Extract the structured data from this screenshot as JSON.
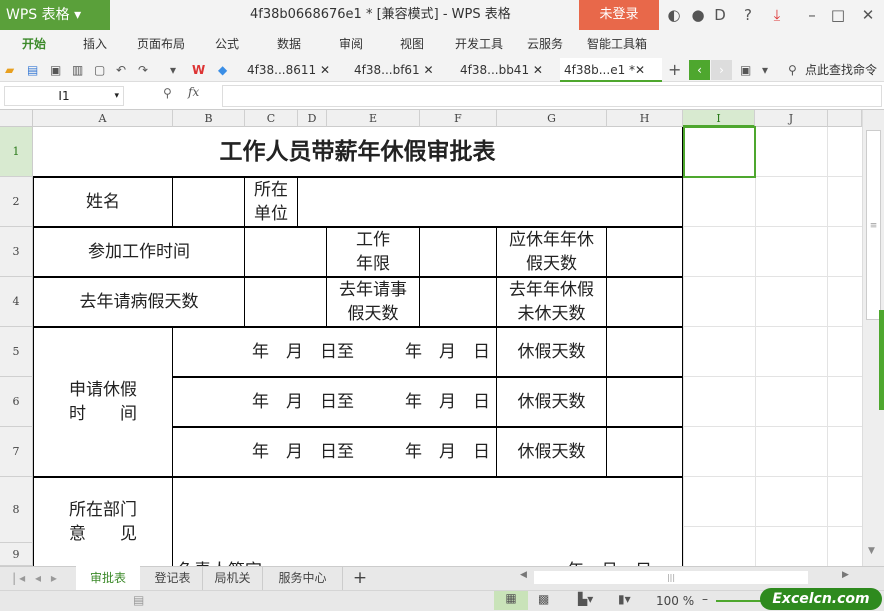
{
  "app": {
    "logo": "WPS 表格",
    "title": "4f38b0668676e1 * [兼容模式] - WPS 表格",
    "login": "未登录"
  },
  "menu": [
    "开始",
    "插入",
    "页面布局",
    "公式",
    "数据",
    "审阅",
    "视图",
    "开发工具",
    "云服务",
    "智能工具箱"
  ],
  "doc_tabs": [
    "4f38...8611",
    "4f38...bf61",
    "4f38...bb41",
    "4f38b...e1 *"
  ],
  "search_cmd": "点此查找命令",
  "formula": {
    "cell": "I1",
    "fx": "fx",
    "value": ""
  },
  "columns": [
    "A",
    "B",
    "C",
    "D",
    "E",
    "F",
    "G",
    "H",
    "I",
    "J"
  ],
  "rows": [
    "1",
    "2",
    "3",
    "4",
    "5",
    "6",
    "7",
    "8",
    "9"
  ],
  "form": {
    "title": "工作人员带薪年休假审批表",
    "name": "姓名",
    "unit": "所在单位",
    "work_start": "参加工作时间",
    "work_years": "工作年限",
    "due_days": "应休年年休假天数",
    "sick_days": "去年请病假天数",
    "personal_days": "去年请事假天数",
    "unused_days": "去年年休假未休天数",
    "apply": "申请休假时　　间",
    "period": "年　月　日至　　　年　月　日",
    "leave_days": "休假天数",
    "dept": "所在部门意　　见",
    "sign": "负责人签字",
    "date": "年　月　日"
  },
  "sheets": [
    "审批表",
    "登记表",
    "局机关",
    "服务中心"
  ],
  "status": {
    "zoom": "100 %",
    "watermark": "Excelcn.com"
  },
  "colors": {
    "green": "#5aa03a",
    "login": "#e8684a",
    "selected": "#4ea72e"
  }
}
